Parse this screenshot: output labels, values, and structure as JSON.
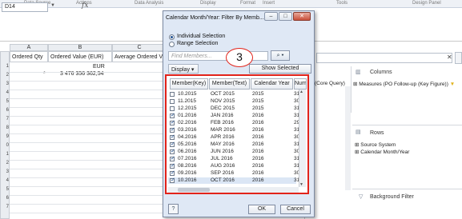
{
  "ribbon": {
    "groups": [
      "Data Source",
      "Actions",
      "Data Analysis",
      "Display",
      "Format",
      "Insert",
      "Tools",
      "Design Panel"
    ]
  },
  "formula_bar": {
    "cell_ref": "D14",
    "fx_label": "fx"
  },
  "sheet": {
    "columns": [
      "A",
      "B",
      "C"
    ],
    "headers": [
      "Ordered Qty",
      "Ordered Value (EUR)",
      "Average Ordered V"
    ],
    "unit_row": {
      "unit": "EUR"
    },
    "data_row": {
      "qty": "*",
      "value": "3 476 356 362,54"
    },
    "row_numbers": [
      "1",
      "2",
      "3",
      "4",
      "5",
      "6",
      "7",
      "8",
      "9",
      "0",
      "1",
      "2",
      "3",
      "4",
      "5",
      "6",
      "7"
    ]
  },
  "dialog": {
    "title": "Calendar Month/Year: Filter By Memb...",
    "window_buttons": [
      "–",
      "□",
      "✕"
    ],
    "radio_individual": "Individual Selection",
    "radio_range": "Range Selection",
    "find_placeholder": "Find Members...",
    "find_button": "⌕ ▾",
    "display_label": "Display",
    "show_selected": "Show Selected",
    "callout_number": "3",
    "columns": [
      "Member(Key)",
      "Member(Text)",
      "Calendar Year",
      "Numb"
    ],
    "rows": [
      {
        "key": "10.2015",
        "text": "OCT 2015",
        "year": "2015",
        "num": "31",
        "checked": false
      },
      {
        "key": "11.2015",
        "text": "NOV 2015",
        "year": "2015",
        "num": "30",
        "checked": false
      },
      {
        "key": "12.2015",
        "text": "DEC 2015",
        "year": "2015",
        "num": "31",
        "checked": false
      },
      {
        "key": "01.2016",
        "text": "JAN 2016",
        "year": "2016",
        "num": "31",
        "checked": true
      },
      {
        "key": "02.2016",
        "text": "FEB 2016",
        "year": "2016",
        "num": "29",
        "checked": true
      },
      {
        "key": "03.2016",
        "text": "MAR 2016",
        "year": "2016",
        "num": "31",
        "checked": true
      },
      {
        "key": "04.2016",
        "text": "APR 2016",
        "year": "2016",
        "num": "30",
        "checked": true
      },
      {
        "key": "05.2016",
        "text": "MAY 2016",
        "year": "2016",
        "num": "31",
        "checked": true
      },
      {
        "key": "06.2016",
        "text": "JUN 2016",
        "year": "2016",
        "num": "30",
        "checked": true
      },
      {
        "key": "07.2016",
        "text": "JUL 2016",
        "year": "2016",
        "num": "31",
        "checked": true
      },
      {
        "key": "08.2016",
        "text": "AUG 2016",
        "year": "2016",
        "num": "31",
        "checked": true
      },
      {
        "key": "09.2016",
        "text": "SEP 2016",
        "year": "2016",
        "num": "30",
        "checked": true
      },
      {
        "key": "10.2016",
        "text": "OCT 2016",
        "year": "2016",
        "num": "31",
        "checked": true
      }
    ],
    "ok_label": "OK",
    "cancel_label": "Cancel",
    "help_label": "?"
  },
  "right_panel": {
    "search_clear": "✕",
    "source_label": "(Core Query)",
    "columns_title": "Columns",
    "columns_items": [
      "Measures (PO Follow-up (Key Figure))"
    ],
    "rows_title": "Rows",
    "rows_items": [
      "Source System",
      "Calendar Month/Year"
    ],
    "background_filter_title": "Background Filter"
  },
  "colors": {
    "highlight_red": "#e2231a",
    "accent_blue": "#1d4f91",
    "dialog_bg": "#dfe8f5"
  }
}
